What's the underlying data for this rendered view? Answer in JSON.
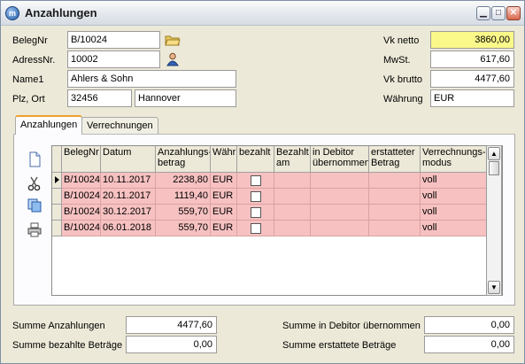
{
  "window": {
    "title": "Anzahlungen"
  },
  "header": {
    "belegnr_label": "BelegNr",
    "belegnr_value": "B/10024",
    "adressnr_label": "AdressNr.",
    "adressnr_value": "10002",
    "name1_label": "Name1",
    "name1_value": "Ahlers & Sohn",
    "plzort_label": "Plz, Ort",
    "plz_value": "32456",
    "ort_value": "Hannover",
    "vknetto_label": "Vk netto",
    "vknetto_value": "3860,00",
    "mwst_label": "MwSt.",
    "mwst_value": "617,60",
    "vkbrutto_label": "Vk brutto",
    "vkbrutto_value": "4477,60",
    "waehrung_label": "Währung",
    "waehrung_value": "EUR"
  },
  "tabs": [
    {
      "label": "Anzahlungen",
      "active": true
    },
    {
      "label": "Verrechnungen",
      "active": false
    }
  ],
  "table": {
    "columns": [
      "BelegNr",
      "Datum",
      "Anzahlungs-\nbetrag",
      "Währ",
      "bezahlt",
      "Bezahlt\nam",
      "in Debitor\nübernommen",
      "erstatteter\nBetrag",
      "Verrechnungs-\nmodus"
    ],
    "rows": [
      {
        "belegnr": "B/10024",
        "datum": "10.11.2017",
        "betrag": "2238,80",
        "waehr": "EUR",
        "bezahlt": false,
        "bezahlt_am": "",
        "debitor": "",
        "erstattet": "",
        "modus": "voll"
      },
      {
        "belegnr": "B/10024",
        "datum": "20.11.2017",
        "betrag": "1119,40",
        "waehr": "EUR",
        "bezahlt": false,
        "bezahlt_am": "",
        "debitor": "",
        "erstattet": "",
        "modus": "voll"
      },
      {
        "belegnr": "B/10024",
        "datum": "30.12.2017",
        "betrag": "559,70",
        "waehr": "EUR",
        "bezahlt": false,
        "bezahlt_am": "",
        "debitor": "",
        "erstattet": "",
        "modus": "voll"
      },
      {
        "belegnr": "B/10024",
        "datum": "06.01.2018",
        "betrag": "559,70",
        "waehr": "EUR",
        "bezahlt": false,
        "bezahlt_am": "",
        "debitor": "",
        "erstattet": "",
        "modus": "voll"
      }
    ]
  },
  "totals": {
    "summe_anzahlungen_label": "Summe Anzahlungen",
    "summe_anzahlungen_value": "4477,60",
    "summe_bezahlt_label": "Summe bezahlte Beträge",
    "summe_bezahlt_value": "0,00",
    "summe_debitor_label": "Summe in Debitor übernommen",
    "summe_debitor_value": "0,00",
    "summe_erstattet_label": "Summe erstattete Beträge",
    "summe_erstattet_value": "0,00"
  },
  "icons": {
    "titlebar": "app-icon",
    "belegnr_button": "folder-open-icon",
    "adressnr_button": "person-icon",
    "tools": [
      "new-document-icon",
      "scissors-icon",
      "copy-icon",
      "printer-icon"
    ]
  },
  "colors": {
    "row_highlight": "#f7c1c1",
    "vknetto_highlight": "#fbf88a",
    "active_tab_accent": "#f0a030"
  }
}
